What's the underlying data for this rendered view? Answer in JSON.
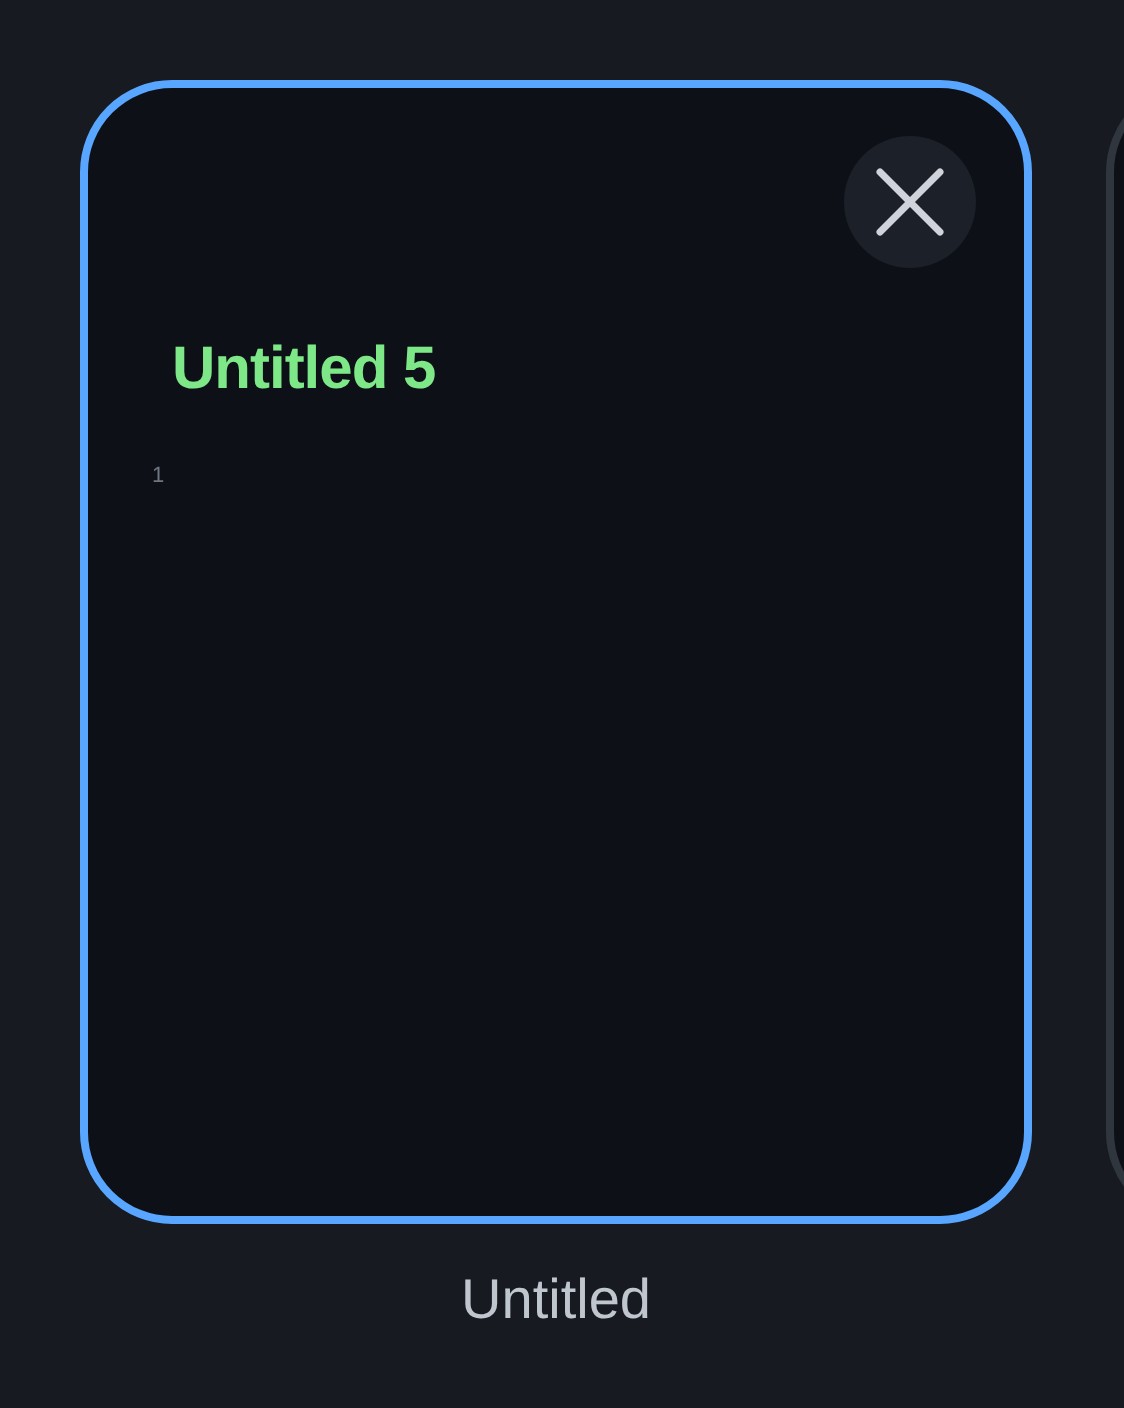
{
  "tabs": [
    {
      "title": "Untitled 5",
      "line_numbers": [
        "1"
      ],
      "caption": "Untitled",
      "selected": true
    },
    {
      "selected": false
    }
  ]
}
